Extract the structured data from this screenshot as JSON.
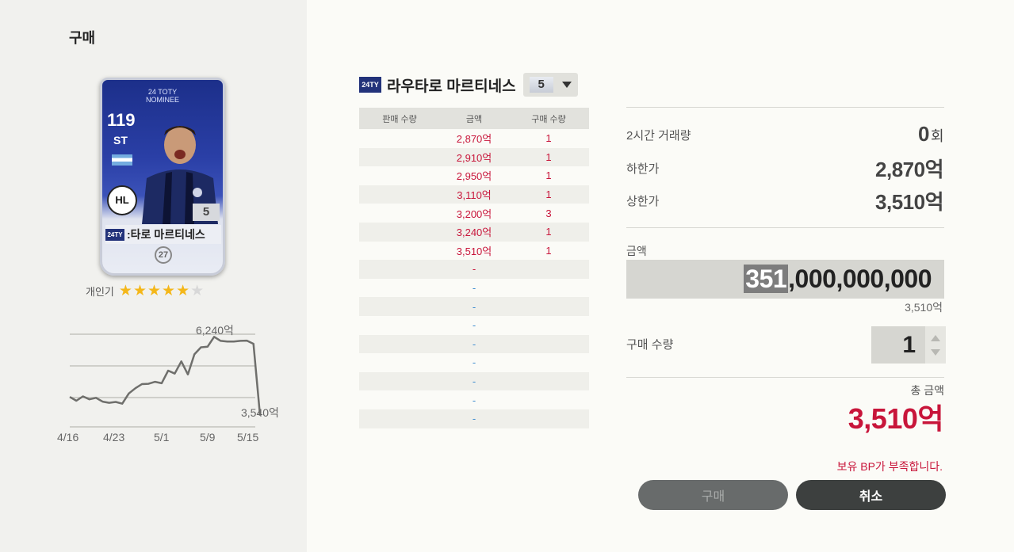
{
  "panel_title": "구매",
  "card": {
    "top_label_1": "24 TOTY",
    "top_label_2": "NOMINEE",
    "ovr": "119",
    "position": "ST",
    "club_badge": "HL",
    "level": "5",
    "season_badge": "24TY",
    "name": "라우타로 마르티네스",
    "name_visible": ":타로 마르티네스",
    "salary": "27"
  },
  "popularity": {
    "label": "개인기",
    "stars_filled": 5,
    "stars_total": 6
  },
  "price_history": {
    "max_label": "6,240억",
    "last_label": "3,540억",
    "x_labels": [
      "4/16",
      "4/23",
      "5/1",
      "5/9",
      "5/15"
    ]
  },
  "chart_data": {
    "type": "line",
    "title": "",
    "xlabel": "",
    "ylabel": "",
    "x": [
      "4/16",
      "4/23",
      "5/1",
      "5/9",
      "5/15"
    ],
    "series": [
      {
        "values": [
          4180,
          4050,
          4200,
          4100,
          4150,
          4020,
          3980,
          4010,
          3950,
          4300,
          4480,
          4620,
          4630,
          4700,
          4650,
          5080,
          4980,
          5400,
          4950,
          5640,
          5880,
          5900,
          6240,
          6100,
          6080,
          6080,
          6100,
          6110,
          6000,
          3540
        ]
      }
    ],
    "annotations": [
      {
        "text": "6,240억",
        "value": 6240
      },
      {
        "text": "3,540억",
        "value": 3540
      }
    ],
    "ylim": [
      3400,
      6600
    ],
    "grid": true
  },
  "header": {
    "season_badge": "24TY",
    "player_name": "라우타로 마르티네스",
    "level_value": "5"
  },
  "order_table": {
    "headers": {
      "sell_qty": "판매 수량",
      "price": "금액",
      "buy_qty": "구매 수량"
    },
    "rows": [
      {
        "sell": "",
        "price": "2,870억",
        "qty": "1"
      },
      {
        "sell": "",
        "price": "2,910억",
        "qty": "1"
      },
      {
        "sell": "",
        "price": "2,950억",
        "qty": "1"
      },
      {
        "sell": "",
        "price": "3,110억",
        "qty": "1"
      },
      {
        "sell": "",
        "price": "3,200억",
        "qty": "3"
      },
      {
        "sell": "",
        "price": "3,240억",
        "qty": "1"
      },
      {
        "sell": "",
        "price": "3,510억",
        "qty": "1"
      },
      {
        "sell": "",
        "price": "-",
        "qty": ""
      },
      {
        "sell": "",
        "price": "-",
        "qty": ""
      },
      {
        "sell": "",
        "price": "-",
        "qty": ""
      },
      {
        "sell": "",
        "price": "-",
        "qty": ""
      },
      {
        "sell": "",
        "price": "-",
        "qty": ""
      },
      {
        "sell": "",
        "price": "-",
        "qty": ""
      },
      {
        "sell": "",
        "price": "-",
        "qty": ""
      },
      {
        "sell": "",
        "price": "-",
        "qty": ""
      },
      {
        "sell": "",
        "price": "-",
        "qty": ""
      }
    ]
  },
  "stats": {
    "volume_label": "2시간 거래량",
    "volume_value": "0",
    "volume_unit": "회",
    "low_label": "하한가",
    "low_value": "2,870억",
    "high_label": "상한가",
    "high_value": "3,510억"
  },
  "amount": {
    "label": "금액",
    "value_selected": "351",
    "value_rest": ",000,000,000",
    "sub": "3,510억"
  },
  "quantity": {
    "label": "구매 수량",
    "value": "1"
  },
  "total": {
    "label": "총 금액",
    "value": "3,510억"
  },
  "warning": "보유 BP가 부족합니다.",
  "buttons": {
    "buy": "구매",
    "cancel": "취소"
  },
  "colors": {
    "accent_red": "#c8153a",
    "blue_dash": "#3f8dd0",
    "panel_bg": "#f1f1ee"
  }
}
